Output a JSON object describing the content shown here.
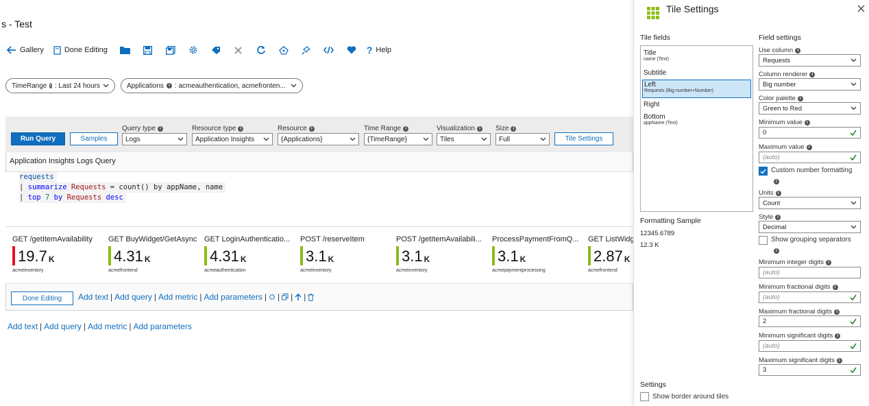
{
  "workbook": {
    "title": "s - Test",
    "toolbar": {
      "gallery_label": "Gallery",
      "done_editing_label": "Done Editing",
      "help_label": "Help"
    },
    "params": {
      "time_range_label": "TimeRange",
      "time_range_value": ": Last 24 hours",
      "applications_label": "Applications",
      "applications_value": ":  acmeauthentication, acmefronten..."
    },
    "query": {
      "run_query": "Run Query",
      "samples": "Samples",
      "query_type_label": "Query type",
      "query_type_value": "Logs",
      "resource_type_label": "Resource type",
      "resource_type_value": "Application Insights",
      "resource_label": "Resource",
      "resource_value": "{Applications}",
      "time_range_label": "Time Range",
      "time_range_value": "{TimeRange}",
      "visualization_label": "Visualization",
      "visualization_value": "Tiles",
      "size_label": "Size",
      "size_value": "Full",
      "tile_settings": "Tile Settings",
      "heading": "Application Insights Logs Query"
    },
    "code": {
      "line1": "requests",
      "line2_pipe": "| ",
      "line2_kw": "summarize",
      "line2_red": " Requests",
      "line2_rest": " = count() by appName, name",
      "line3_pipe": "| ",
      "line3_kw": "top",
      "line3_num": " 7",
      "line3_kw2": " by",
      "line3_red": " Requests",
      "line3_kw3": " desc"
    },
    "tiles": [
      {
        "title": "GET /getItemAvailability",
        "value": "19.7",
        "unit": "K",
        "sub": "acmeinventory",
        "color": "#e81123"
      },
      {
        "title": "GET BuyWidget/GetAsync",
        "value": "4.31",
        "unit": "K",
        "sub": "acmefrontend",
        "color": "#8cbd18"
      },
      {
        "title": "GET LoginAuthenticatio...",
        "value": "4.31",
        "unit": "K",
        "sub": "acmeauthentication",
        "color": "#8cbd18"
      },
      {
        "title": "POST /reserveItem",
        "value": "3.1",
        "unit": "K",
        "sub": "acmeinventory",
        "color": "#8cbd18"
      },
      {
        "title": "POST /getItemAvailabili...",
        "value": "3.1",
        "unit": "K",
        "sub": "acmeinventory",
        "color": "#8cbd18"
      },
      {
        "title": "ProcessPaymentFromQ...",
        "value": "3.1",
        "unit": "K",
        "sub": "acmepaymentprocessing",
        "color": "#8cbd18"
      },
      {
        "title": "GET ListWidg",
        "value": "2.87",
        "unit": "K",
        "sub": "acmefrontend",
        "color": "#8cbd18"
      }
    ],
    "bottom": {
      "done_editing": "Done Editing",
      "add_text": "Add text",
      "add_query": "Add query",
      "add_metric": "Add metric",
      "add_parameters": "Add parameters",
      "sep": "|"
    }
  },
  "pane": {
    "title": "Tile Settings",
    "tile_fields_heading": "Tile fields",
    "field_settings_heading": "Field settings",
    "fields": [
      {
        "name": "Title",
        "detail": "name (Text)"
      },
      {
        "name": "Subtitle",
        "detail": ""
      },
      {
        "name": "Left",
        "detail": "Requests (Big number+Number)"
      },
      {
        "name": "Right",
        "detail": ""
      },
      {
        "name": "Bottom",
        "detail": "appName (Text)"
      }
    ],
    "formatting_sample_label": "Formatting Sample",
    "sample_raw": "12345.6789",
    "sample_formatted": "12.3 K",
    "use_column_label": "Use column",
    "use_column_value": "Requests",
    "column_renderer_label": "Column renderer",
    "column_renderer_value": "Big number",
    "color_palette_label": "Color palette",
    "color_palette_value": "Green to Red",
    "min_value_label": "Minimum value",
    "min_value": "0",
    "max_value_label": "Maximum value",
    "max_value": "(auto)",
    "custom_number_label": "Custom number formatting",
    "units_label": "Units",
    "units_value": "Count",
    "style_label": "Style",
    "style_value": "Decimal",
    "grouping_label": "Show grouping separators",
    "min_int_label": "Minimum integer digits",
    "min_int_value": "(auto)",
    "min_frac_label": "Minimum fractional digits",
    "min_frac_value": "(auto)",
    "max_frac_label": "Maximum fractional digits",
    "max_frac_value": "2",
    "min_sig_label": "Minimum significant digits",
    "min_sig_value": "(auto)",
    "max_sig_label": "Maximum significant digits",
    "max_sig_value": "3",
    "settings_heading": "Settings",
    "border_label": "Show border around tiles"
  },
  "colors": {
    "accent": "#106ebe",
    "danger": "#e81123",
    "good": "#8cbd18",
    "check_green": "#107c10"
  }
}
